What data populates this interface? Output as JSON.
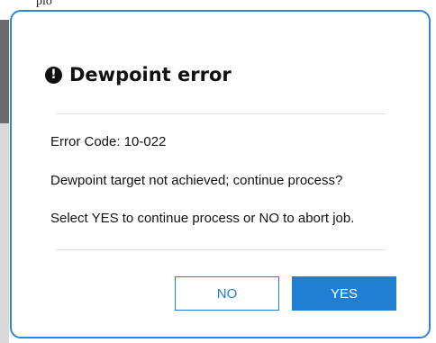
{
  "background": {
    "partial_text": "plo"
  },
  "dialog": {
    "title": "Dewpoint error",
    "alert_icon": "exclamation-circle-icon",
    "alert_glyph": "!",
    "error_code": "Error Code: 10-022",
    "message": "Dewpoint target not achieved; continue process?",
    "instruction": "Select YES to continue process or NO to abort job.",
    "no_label": "NO",
    "yes_label": "YES"
  },
  "colors": {
    "accent": "#1e7fd4",
    "dialog_border": "#2f86d8"
  }
}
